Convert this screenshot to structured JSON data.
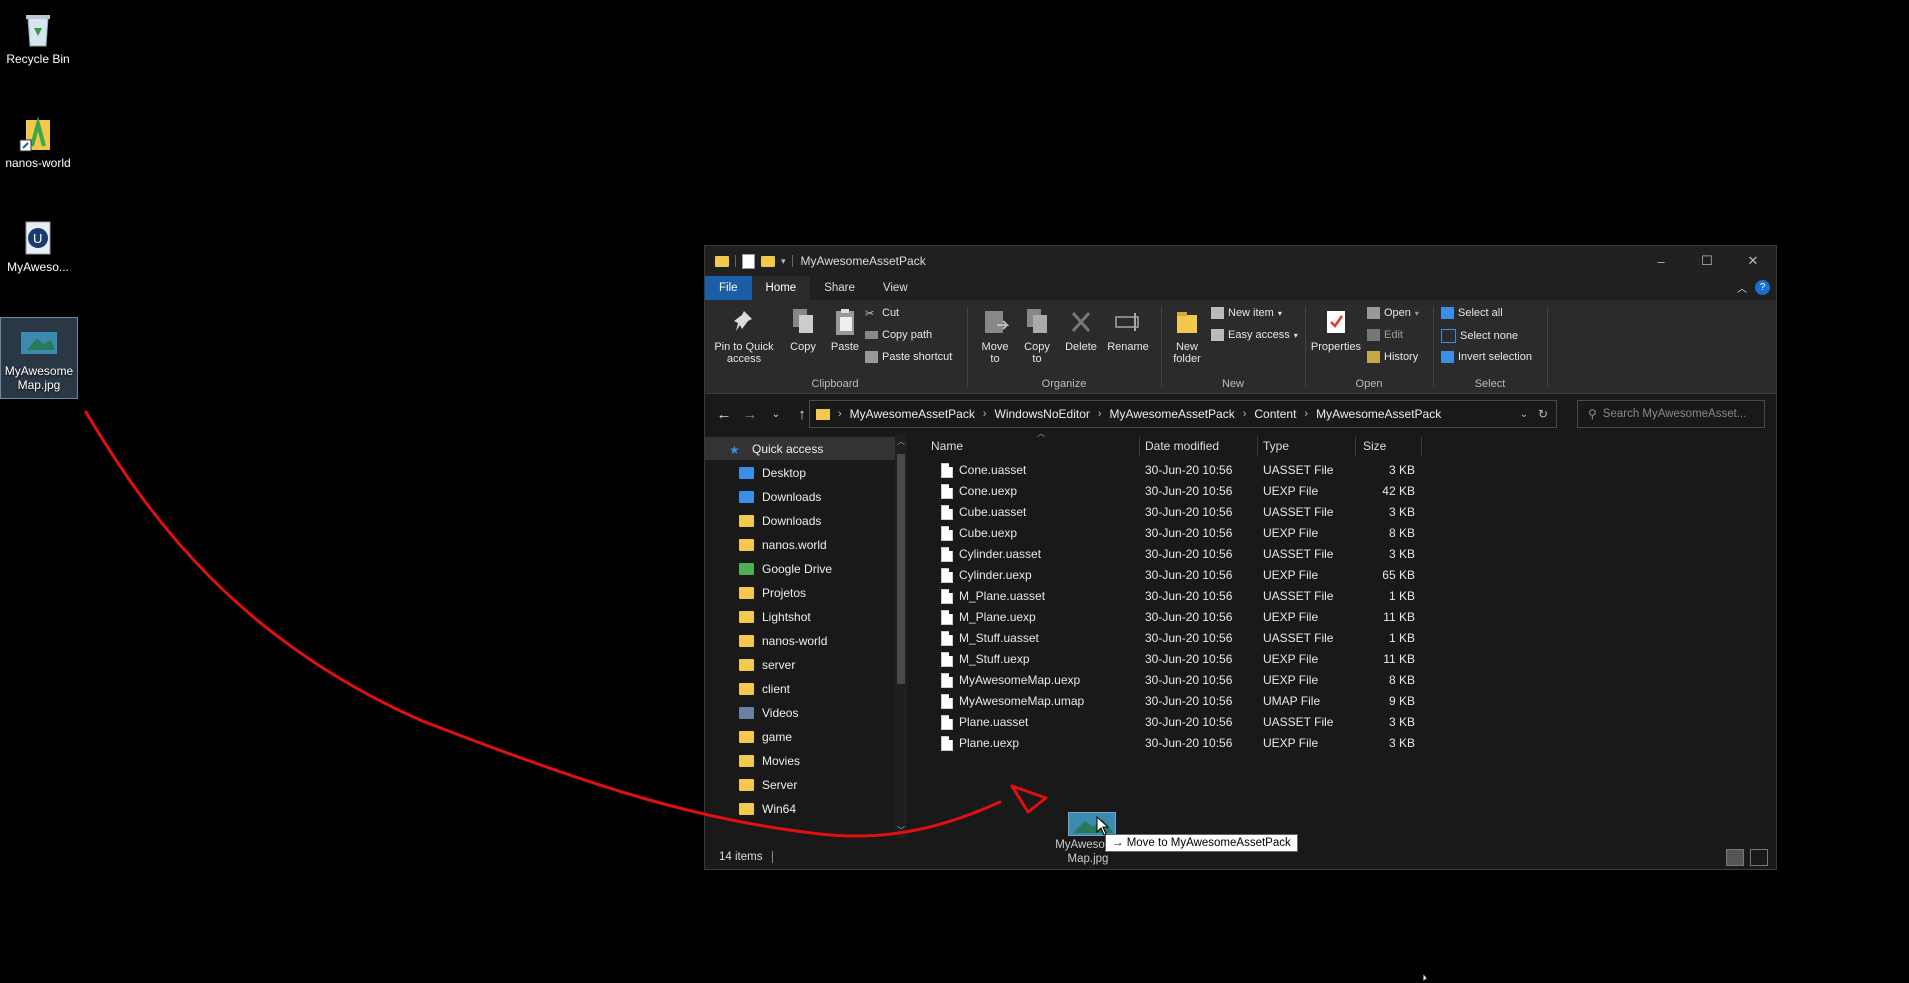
{
  "desktop": {
    "icons": [
      {
        "label": "Recycle Bin",
        "icon": "recycle-bin-icon"
      },
      {
        "label": "nanos-world",
        "icon": "nanos-world-shortcut-icon"
      },
      {
        "label": "MyAweso...",
        "icon": "unreal-engine-icon"
      },
      {
        "label": "MyAwesome\nMap.jpg",
        "icon": "image-file-icon"
      }
    ]
  },
  "window": {
    "title": "MyAwesomeAssetPack",
    "tabs": [
      "File",
      "Home",
      "Share",
      "View"
    ],
    "active_tab": "Home"
  },
  "ribbon": {
    "clipboard": {
      "label": "Clipboard",
      "pin": "Pin to Quick\naccess",
      "copy": "Copy",
      "paste": "Paste",
      "cut": "Cut",
      "copy_path": "Copy path",
      "paste_shortcut": "Paste shortcut"
    },
    "organize": {
      "label": "Organize",
      "move_to": "Move\nto",
      "copy_to": "Copy\nto",
      "delete": "Delete",
      "rename": "Rename"
    },
    "new": {
      "label": "New",
      "new_folder": "New\nfolder",
      "new_item": "New item",
      "easy_access": "Easy access"
    },
    "open": {
      "label": "Open",
      "properties": "Properties",
      "open": "Open",
      "edit": "Edit",
      "history": "History"
    },
    "select": {
      "label": "Select",
      "select_all": "Select all",
      "select_none": "Select none",
      "invert": "Invert selection"
    }
  },
  "address": {
    "crumbs": [
      "MyAwesomeAssetPack",
      "WindowsNoEditor",
      "MyAwesomeAssetPack",
      "Content",
      "MyAwesomeAssetPack"
    ],
    "search_placeholder": "Search MyAwesomeAsset..."
  },
  "nav": {
    "items": [
      {
        "label": "Quick access",
        "icon": "star-icon",
        "pinned": false
      },
      {
        "label": "Desktop",
        "icon": "desktop-icon",
        "pinned": true
      },
      {
        "label": "Downloads",
        "icon": "download-icon",
        "pinned": true
      },
      {
        "label": "Downloads",
        "icon": "folder-icon",
        "pinned": true
      },
      {
        "label": "nanos.world",
        "icon": "folder-icon",
        "pinned": true
      },
      {
        "label": "Google Drive",
        "icon": "google-drive-icon",
        "pinned": true
      },
      {
        "label": "Projetos",
        "icon": "folder-icon",
        "pinned": true
      },
      {
        "label": "Lightshot",
        "icon": "folder-icon",
        "pinned": true
      },
      {
        "label": "nanos-world",
        "icon": "folder-icon",
        "pinned": true
      },
      {
        "label": "server",
        "icon": "folder-icon",
        "pinned": true
      },
      {
        "label": "client",
        "icon": "folder-icon",
        "pinned": true
      },
      {
        "label": "Videos",
        "icon": "videos-icon",
        "pinned": true
      },
      {
        "label": "game",
        "icon": "folder-icon",
        "pinned": false
      },
      {
        "label": "Movies",
        "icon": "folder-icon",
        "pinned": false
      },
      {
        "label": "Server",
        "icon": "folder-icon",
        "pinned": false
      },
      {
        "label": "Win64",
        "icon": "folder-icon",
        "pinned": false
      }
    ]
  },
  "columns": {
    "name": "Name",
    "date": "Date modified",
    "type": "Type",
    "size": "Size"
  },
  "files": [
    {
      "name": "Cone.uasset",
      "date": "30-Jun-20 10:56",
      "type": "UASSET File",
      "size": "3 KB"
    },
    {
      "name": "Cone.uexp",
      "date": "30-Jun-20 10:56",
      "type": "UEXP File",
      "size": "42 KB"
    },
    {
      "name": "Cube.uasset",
      "date": "30-Jun-20 10:56",
      "type": "UASSET File",
      "size": "3 KB"
    },
    {
      "name": "Cube.uexp",
      "date": "30-Jun-20 10:56",
      "type": "UEXP File",
      "size": "8 KB"
    },
    {
      "name": "Cylinder.uasset",
      "date": "30-Jun-20 10:56",
      "type": "UASSET File",
      "size": "3 KB"
    },
    {
      "name": "Cylinder.uexp",
      "date": "30-Jun-20 10:56",
      "type": "UEXP File",
      "size": "65 KB"
    },
    {
      "name": "M_Plane.uasset",
      "date": "30-Jun-20 10:56",
      "type": "UASSET File",
      "size": "1 KB"
    },
    {
      "name": "M_Plane.uexp",
      "date": "30-Jun-20 10:56",
      "type": "UEXP File",
      "size": "11 KB"
    },
    {
      "name": "M_Stuff.uasset",
      "date": "30-Jun-20 10:56",
      "type": "UASSET File",
      "size": "1 KB"
    },
    {
      "name": "M_Stuff.uexp",
      "date": "30-Jun-20 10:56",
      "type": "UEXP File",
      "size": "11 KB"
    },
    {
      "name": "MyAwesomeMap.uexp",
      "date": "30-Jun-20 10:56",
      "type": "UEXP File",
      "size": "8 KB"
    },
    {
      "name": "MyAwesomeMap.umap",
      "date": "30-Jun-20 10:56",
      "type": "UMAP File",
      "size": "9 KB"
    },
    {
      "name": "Plane.uasset",
      "date": "30-Jun-20 10:56",
      "type": "UASSET File",
      "size": "3 KB"
    },
    {
      "name": "Plane.uexp",
      "date": "30-Jun-20 10:56",
      "type": "UEXP File",
      "size": "3 KB"
    }
  ],
  "status": {
    "item_count": "14 items"
  },
  "drag": {
    "label": "MyAwesome\nMap.jpg",
    "tooltip": "→ Move to MyAwesomeAssetPack"
  },
  "colors": {
    "annotation_stroke": "#e01010",
    "folder": "#f2c94c",
    "file_tab": "#1a5ea8"
  }
}
